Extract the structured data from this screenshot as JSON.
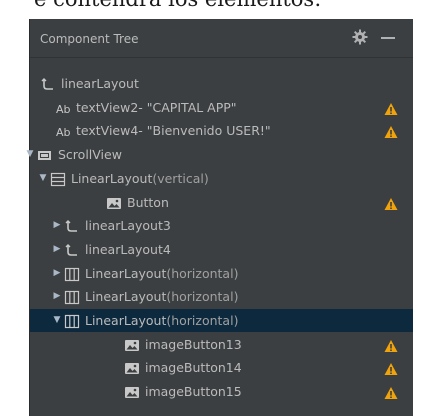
{
  "background_caption": "e contendrá los elementos:",
  "panel": {
    "title": "Component Tree",
    "accent": "#0d293e",
    "warning_color": "#f0a30a"
  },
  "tree": [
    {
      "label": "linearLayout",
      "icon": "layout-icon",
      "arrow": "",
      "depth": 0,
      "warn": false
    },
    {
      "label": "textView2- \"CAPITAL APP\"",
      "icon": "text-icon",
      "arrow": "",
      "depth": 1,
      "warn": true
    },
    {
      "label": "textView4- \"Bienvenido USER!\"",
      "icon": "text-icon",
      "arrow": "",
      "depth": 1,
      "warn": true
    },
    {
      "label": "ScrollView",
      "icon": "scrollview-icon",
      "arrow": "expanded",
      "depth": 0,
      "warn": false
    },
    {
      "label": "LinearLayout",
      "suffix": "(vertical)",
      "icon": "vertical-layout-icon",
      "arrow": "expanded",
      "depth": 1,
      "warn": false
    },
    {
      "label": "Button",
      "icon": "image-icon",
      "arrow": "",
      "depth": 3,
      "warn": true
    },
    {
      "label": "linearLayout3",
      "icon": "layout-icon",
      "arrow": "collapsed",
      "depth": 2,
      "warn": false
    },
    {
      "label": "linearLayout4",
      "icon": "layout-icon",
      "arrow": "collapsed",
      "depth": 2,
      "warn": false
    },
    {
      "label": "LinearLayout",
      "suffix": "(horizontal)",
      "icon": "horizontal-layout-icon",
      "arrow": "collapsed",
      "depth": 2,
      "warn": false
    },
    {
      "label": "LinearLayout",
      "suffix": "(horizontal)",
      "icon": "horizontal-layout-icon",
      "arrow": "collapsed",
      "depth": 2,
      "warn": false
    },
    {
      "label": "LinearLayout",
      "suffix": "(horizontal)",
      "icon": "horizontal-layout-icon",
      "arrow": "expanded",
      "depth": 2,
      "warn": false,
      "selected": true
    },
    {
      "label": "imageButton13",
      "icon": "image-icon",
      "arrow": "",
      "depth": 4,
      "warn": true
    },
    {
      "label": "imageButton14",
      "icon": "image-icon",
      "arrow": "",
      "depth": 4,
      "warn": true
    },
    {
      "label": "imageButton15",
      "icon": "image-icon",
      "arrow": "",
      "depth": 4,
      "warn": true
    }
  ]
}
